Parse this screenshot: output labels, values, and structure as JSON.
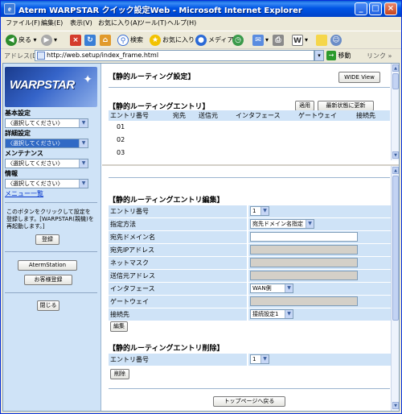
{
  "window": {
    "title": "Aterm WARPSTAR クイック設定Web - Microsoft Internet Explorer",
    "minimize": "_",
    "maximize": "□",
    "close": "×"
  },
  "menu": [
    "ファイル(F)",
    "編集(E)",
    "表示(V)",
    "お気に入り(A)",
    "ツール(T)",
    "ヘルプ(H)"
  ],
  "toolbar": {
    "back": "戻る",
    "search": "検索",
    "favorites": "お気に入り",
    "media": "メディア"
  },
  "address": {
    "label": "アドレス(D)",
    "url": "http://web.setup/index_frame.html",
    "go": "移動",
    "links": "リンク »"
  },
  "sidebar": {
    "logo": "WARPSTAR",
    "sections": [
      {
        "title": "基本設定",
        "value": "〈選択してください〉"
      },
      {
        "title": "詳細設定",
        "value": "〈選択してください〉"
      },
      {
        "title": "メンテナンス",
        "value": "〈選択してください〉"
      },
      {
        "title": "情報",
        "value": "〈選択してください〉"
      }
    ],
    "menu_list": "メニュー一覧",
    "note": "このボタンをクリックして設定を登録します。[WARPSTAR(親機)を再起動します。]",
    "register": "登録",
    "aterm_station": "AtermStation",
    "customer_register": "お客様登録",
    "close": "閉じる"
  },
  "top": {
    "title": "【静的ルーティング設定】",
    "wide_view": "WIDE View",
    "entry_title": "【静的ルーティングエントリ】",
    "apply": "適用",
    "refresh": "最新状態に更新",
    "columns": [
      "エントリ番号",
      "宛先",
      "送信元",
      "インタフェース",
      "ゲートウェイ",
      "接続先"
    ],
    "rows": [
      "01",
      "02",
      "03"
    ]
  },
  "edit": {
    "title": "【静的ルーティングエントリ編集】",
    "fields": [
      {
        "label": "エントリ番号",
        "value": "1"
      },
      {
        "label": "指定方法",
        "value": "宛先ドメイン名指定"
      },
      {
        "label": "宛先ドメイン名",
        "value": ""
      },
      {
        "label": "宛先IPアドレス",
        "value": ""
      },
      {
        "label": "ネットマスク",
        "value": ""
      },
      {
        "label": "送信元アドレス",
        "value": ""
      },
      {
        "label": "インタフェース",
        "value": "WAN側"
      },
      {
        "label": "ゲートウェイ",
        "value": ""
      },
      {
        "label": "接続先",
        "value": "接続設定1"
      }
    ],
    "edit_button": "編集"
  },
  "delete": {
    "title": "【静的ルーティングエントリ削除】",
    "entry_label": "エントリ番号",
    "entry_value": "1",
    "delete_button": "削除"
  },
  "back_to_top": "トップページへ戻る"
}
